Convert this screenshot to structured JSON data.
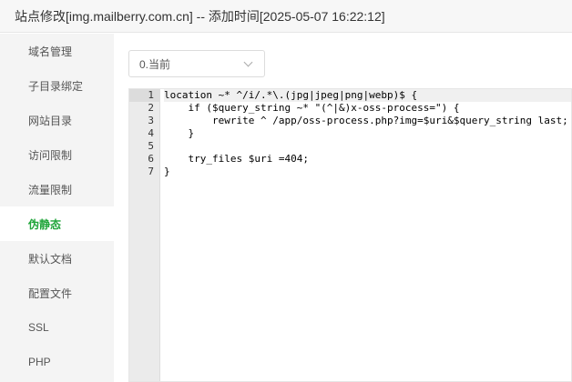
{
  "window": {
    "title": "站点修改[img.mailberry.com.cn] -- 添加时间[2025-05-07 16:22:12]"
  },
  "sidebar": {
    "items": [
      {
        "label": "域名管理"
      },
      {
        "label": "子目录绑定"
      },
      {
        "label": "网站目录"
      },
      {
        "label": "访问限制"
      },
      {
        "label": "流量限制"
      },
      {
        "label": "伪静态",
        "active": true
      },
      {
        "label": "默认文档"
      },
      {
        "label": "配置文件"
      },
      {
        "label": "SSL"
      },
      {
        "label": "PHP"
      }
    ]
  },
  "main": {
    "version_select": {
      "value": "0.当前"
    },
    "editor": {
      "line_numbers": [
        "1",
        "2",
        "3",
        "4",
        "5",
        "6",
        "7"
      ],
      "active_line": 1,
      "lines": [
        "location ~* ^/i/.*\\.(jpg|jpeg|png|webp)$ {",
        "    if ($query_string ~* \"(^|&)x-oss-process=\") {",
        "        rewrite ^ /app/oss-process.php?img=$uri&$query_string last;",
        "    }",
        "",
        "    try_files $uri =404;",
        "}"
      ]
    }
  },
  "colors": {
    "accent": "#20a53a",
    "sidebar_bg": "#f4f4f4",
    "gutter_bg": "#ebebeb"
  }
}
